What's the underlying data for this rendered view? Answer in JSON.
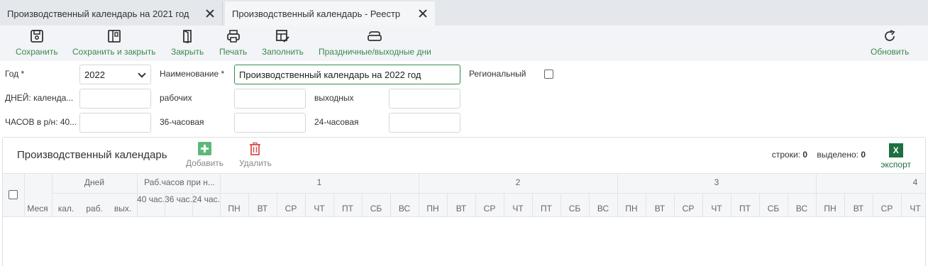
{
  "tabs": [
    {
      "label": "Производственный календарь на 2021 год"
    },
    {
      "label": "Производственный календарь - Реестр"
    }
  ],
  "toolbar": {
    "save": "Сохранить",
    "save_close": "Сохранить и закрыть",
    "close": "Закрыть",
    "print": "Печать",
    "fill": "Заполнить",
    "holidays": "Праздничные/выходные дни",
    "refresh": "Обновить"
  },
  "form": {
    "year_label": "Год *",
    "year_value": "2022",
    "name_label": "Наименование *",
    "name_value": "Производственный календарь на 2022 год",
    "regional_label": "Региональный",
    "days_calendar_label": "ДНЕЙ: календа...",
    "working_label": "рабочих",
    "weekend_label": "выходных",
    "hours_label": "ЧАСОВ в р/н: 40...",
    "hours36_label": "36-часовая",
    "hours24_label": "24-часовая"
  },
  "grid": {
    "title": "Производственный календарь",
    "add": "Добавить",
    "delete": "Удалить",
    "rows_label": "строки:",
    "rows_value": "0",
    "selected_label": "выделено:",
    "selected_value": "0",
    "export_icon": "X",
    "export_label": "экспорт",
    "col_month": "Меся",
    "grp_days": "Дней",
    "grp_hours": "Раб.часов при н...",
    "sub_days": [
      "кал.",
      "раб.",
      "вых."
    ],
    "sub_hours": [
      "40 час.",
      "36 час.",
      "24 час."
    ],
    "weeks": [
      "1",
      "2",
      "3",
      "4"
    ],
    "weekdays": [
      "ПН",
      "ВТ",
      "СР",
      "ЧТ",
      "ПТ",
      "СБ",
      "ВС"
    ]
  },
  "colors": {
    "accent": "#3b8a4e",
    "add": "#5cb87a",
    "delete": "#d9534f",
    "excel": "#1d6f42"
  }
}
